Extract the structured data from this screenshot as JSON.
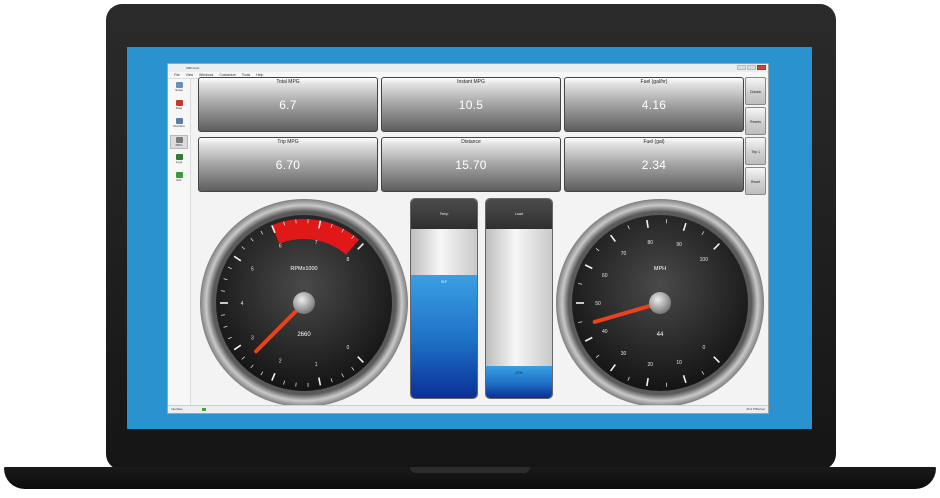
{
  "window": {
    "title": "OBD Auto",
    "menu": [
      "File",
      "View",
      "Windows",
      "Customize",
      "Tools",
      "Help"
    ]
  },
  "sidebar": {
    "items": [
      {
        "label": "Setup",
        "icon": "setup-icon",
        "color": "#6a8fbf"
      },
      {
        "label": "Diag",
        "icon": "diagnostics-icon",
        "color": "#c0392b"
      },
      {
        "label": "Monitors",
        "icon": "monitors-icon",
        "color": "#5a7ea8"
      },
      {
        "label": "MPG",
        "icon": "dashboard-icon",
        "color": "#7a7a7a"
      },
      {
        "label": "Logs",
        "icon": "logs-icon",
        "color": "#2f7d32"
      },
      {
        "label": "Exit",
        "icon": "exit-icon",
        "color": "#3c9a3c"
      }
    ]
  },
  "tiles": [
    {
      "label": "Total MPG",
      "value": "6.7"
    },
    {
      "label": "Instant MPG",
      "value": "10.5"
    },
    {
      "label": "Fuel (gal/hr)",
      "value": "4.16"
    },
    {
      "label": "Trip MPG",
      "value": "6.70"
    },
    {
      "label": "Distance",
      "value": "15.70"
    },
    {
      "label": "Fuel (gal)",
      "value": "2.34"
    }
  ],
  "right_buttons": [
    "Classic",
    "Resets",
    "Trip 1",
    "Reset"
  ],
  "gauges": {
    "rpm": {
      "title": "RPMx1000",
      "readout": "2660",
      "value": 2.66,
      "min": 0,
      "max": 8,
      "ticks": [
        "0",
        "1",
        "2",
        "3",
        "4",
        "5",
        "6",
        "7",
        "8"
      ],
      "redline_start": 6.0,
      "needle_color": "#e8421f",
      "redline_color": "#e01818"
    },
    "speed": {
      "title": "MPH",
      "readout": "44",
      "value": 44,
      "min": 0,
      "max": 100,
      "ticks": [
        "0",
        "10",
        "20",
        "30",
        "40",
        "50",
        "60",
        "70",
        "80",
        "90",
        "100"
      ],
      "needle_color": "#e8421f"
    }
  },
  "bars": [
    {
      "title": "Temp",
      "value_text": "91F",
      "fill": 0.73
    },
    {
      "title": "Load",
      "value_text": "21%",
      "fill": 0.19
    }
  ],
  "status": {
    "left": "Interface",
    "right": "26.4 PIDs/sec"
  }
}
